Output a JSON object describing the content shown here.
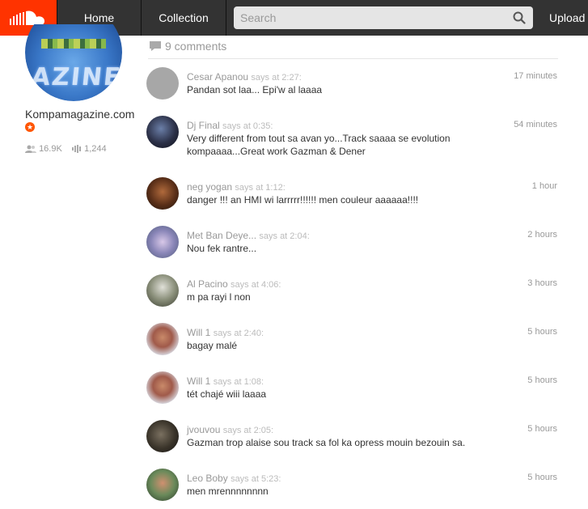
{
  "nav": {
    "home": "Home",
    "collection": "Collection",
    "search_placeholder": "Search",
    "upload": "Upload",
    "brand_color": "#ff3300"
  },
  "profile": {
    "name": "Kompamagazine.com",
    "followers": "16.9K",
    "tracks": "1,244"
  },
  "comments_header": {
    "count_label": "9 comments"
  },
  "comments": [
    {
      "user": "Cesar Apanou",
      "says": "says at 2:27:",
      "time": "17 minutes",
      "text": "Pandan sot laa... Epi'w al laaaa"
    },
    {
      "user": "Dj Final",
      "says": "says at 0:35:",
      "time": "54 minutes",
      "text": "Very different from tout sa avan yo...Track saaaa se evolution kompaaaa...Great work Gazman & Dener"
    },
    {
      "user": "neg yogan",
      "says": "says at 1:12:",
      "time": "1 hour",
      "text": "danger !!! an HMI wi larrrrr!!!!!! men couleur aaaaaa!!!!"
    },
    {
      "user": "Met Ban Deye...",
      "says": "says at 2:04:",
      "time": "2 hours",
      "text": "Nou fek rantre..."
    },
    {
      "user": "Al Pacino",
      "says": "says at 4:06:",
      "time": "3 hours",
      "text": "m pa rayi l non"
    },
    {
      "user": "Will 1",
      "says": "says at 2:40:",
      "time": "5 hours",
      "text": "bagay malé"
    },
    {
      "user": "Will 1",
      "says": "says at 1:08:",
      "time": "5 hours",
      "text": "tét chajé wiii laaaa"
    },
    {
      "user": "jvouvou",
      "says": "says at 2:05:",
      "time": "5 hours",
      "text": "Gazman trop alaise sou track sa fol ka opress mouin bezouin sa."
    },
    {
      "user": "Leo Boby",
      "says": "says at 5:23:",
      "time": "5 hours",
      "text": "men mrennnnnnnn"
    }
  ]
}
